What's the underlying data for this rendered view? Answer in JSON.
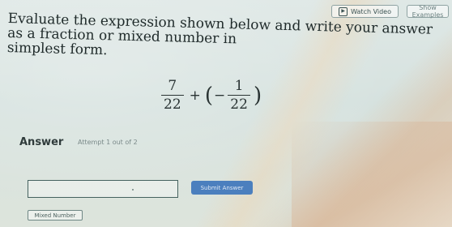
{
  "toolbar": {
    "watch_video_label": "Watch Video",
    "show_examples_label": "Show Examples"
  },
  "question": {
    "prompt_line1": "Evaluate the expression shown below and write your answer as a fraction or mixed number in",
    "prompt_line2": "simplest form.",
    "expression": {
      "term1_numerator": "7",
      "term1_denominator": "22",
      "operator": "+",
      "open_paren": "(",
      "sign": "−",
      "term2_numerator": "1",
      "term2_denominator": "22",
      "close_paren": ")"
    }
  },
  "answer": {
    "label": "Answer",
    "attempt_text": "Attempt 1 out of 2",
    "input_value": "",
    "submit_label": "Submit Answer",
    "mixed_number_label": "Mixed Number"
  }
}
